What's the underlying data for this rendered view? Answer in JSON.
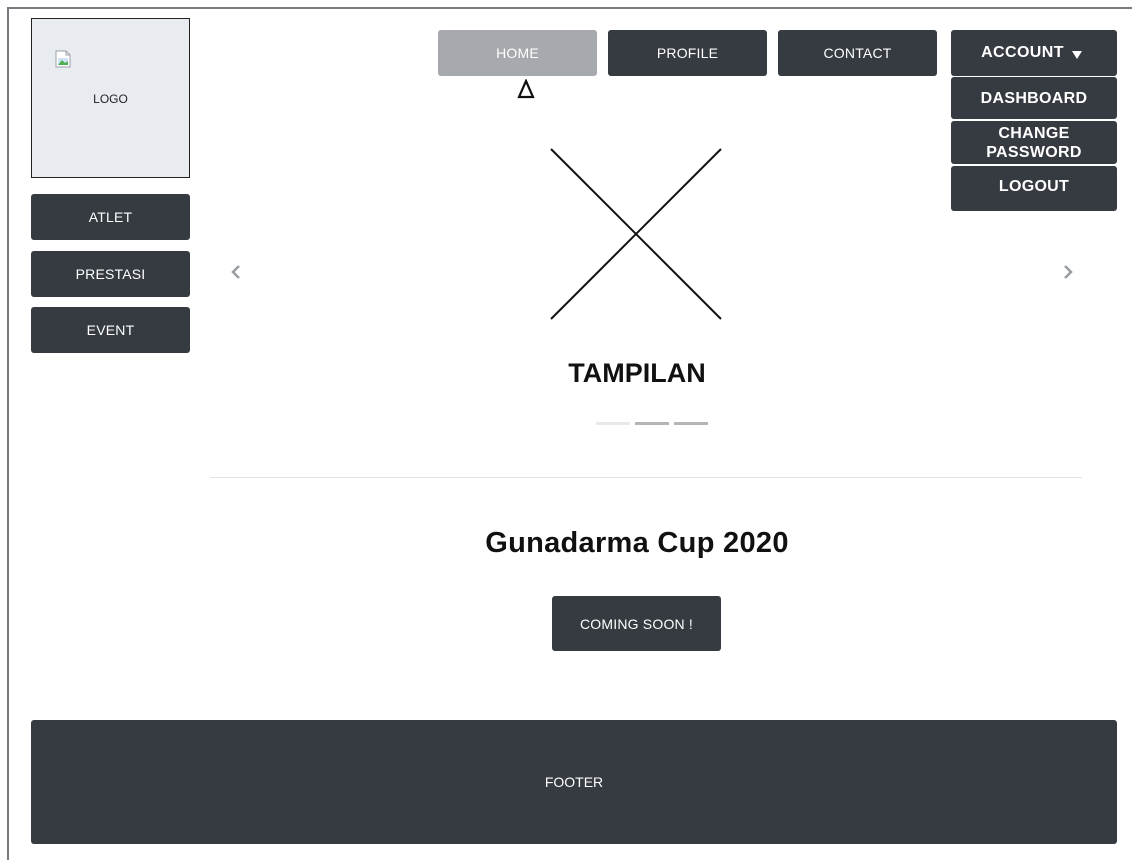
{
  "logo": {
    "label": "LOGO"
  },
  "sidebar": {
    "items": [
      {
        "label": "ATLET"
      },
      {
        "label": "PRESTASI"
      },
      {
        "label": "EVENT"
      }
    ]
  },
  "nav": {
    "items": [
      {
        "label": "HOME",
        "active": true
      },
      {
        "label": "PROFILE"
      },
      {
        "label": "CONTACT"
      }
    ]
  },
  "account": {
    "label": "ACCOUNT",
    "caret_icon": "caret-down-icon",
    "menu": [
      {
        "label": "DASHBOARD"
      },
      {
        "label": "CHANGE PASSWORD"
      },
      {
        "label": "LOGOUT"
      }
    ]
  },
  "carousel": {
    "title": "TAMPILAN",
    "image_icon": "image-placeholder-icon",
    "prev_icon": "chevron-left-icon",
    "next_icon": "chevron-right-icon",
    "slide_count": 3,
    "active_index": 0
  },
  "event": {
    "title": "Gunadarma Cup 2020",
    "button_label": "COMING SOON !"
  },
  "footer": {
    "label": "FOOTER"
  },
  "colors": {
    "dark": "#363a41",
    "active_nav": "#a6a9ad",
    "logo_bg": "#e8ebef"
  }
}
